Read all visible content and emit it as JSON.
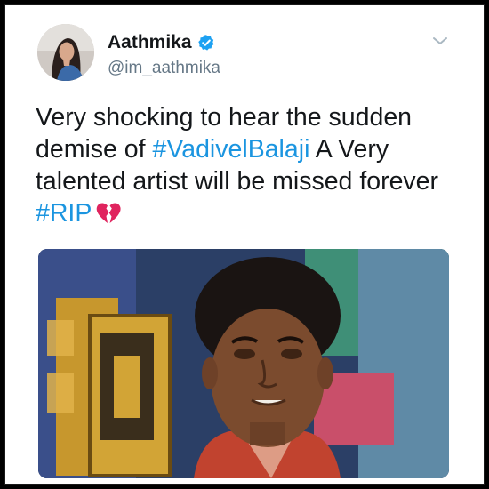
{
  "tweet": {
    "display_name": "Aathmika",
    "handle": "@im_aathmika",
    "verified": true,
    "text_part1": "Very shocking to hear the sudden demise of ",
    "hashtag1": "#VadivelBalaji",
    "text_part2": " A Very talented artist will be missed forever ",
    "hashtag2": "#RIP",
    "emoji": "broken-heart-icon"
  },
  "colors": {
    "text": "#14171a",
    "secondary": "#657786",
    "link": "#1b95e0",
    "verified_badge": "#1da1f2",
    "broken_heart": "#e0245e"
  }
}
